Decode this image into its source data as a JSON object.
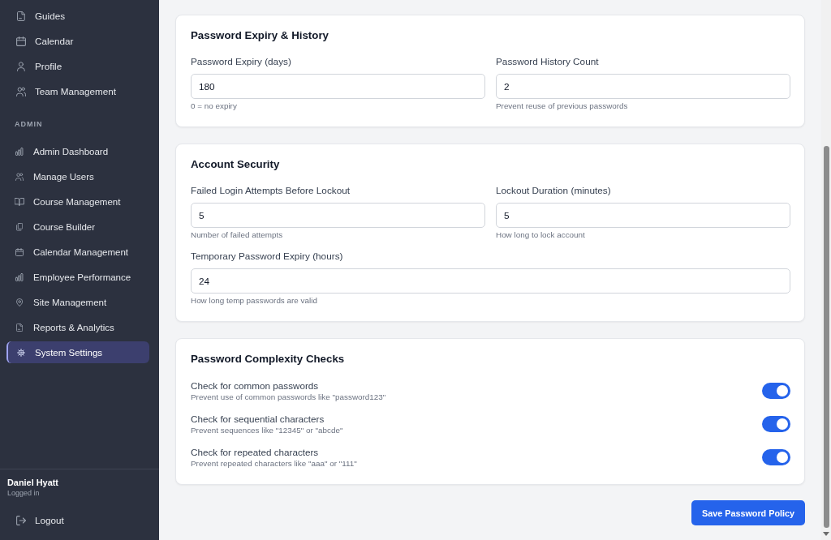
{
  "sidebar": {
    "items": [
      {
        "label": "Guides",
        "selected": false
      },
      {
        "label": "Calendar",
        "selected": false
      },
      {
        "label": "Profile",
        "selected": false
      },
      {
        "label": "Team Management",
        "selected": false
      }
    ],
    "admin_section": {
      "heading": "ADMIN",
      "items": [
        {
          "label": "Admin Dashboard",
          "selected": false
        },
        {
          "label": "Manage Users",
          "selected": false
        },
        {
          "label": "Course Management",
          "selected": false
        },
        {
          "label": "Course Builder",
          "selected": false
        },
        {
          "label": "Calendar Management",
          "selected": false
        },
        {
          "label": "Employee Performance",
          "selected": false
        },
        {
          "label": "Site Management",
          "selected": false
        },
        {
          "label": "Reports & Analytics",
          "selected": false
        },
        {
          "label": "System Settings",
          "selected": true
        }
      ]
    },
    "user": {
      "name": "Daniel Hyatt",
      "status": "Logged in"
    },
    "logout": {
      "label": "Logout"
    }
  },
  "cards": [
    {
      "kind": "fields",
      "title": "Password Expiry & History",
      "rows": [
        [
          {
            "label": "Password Expiry (days)",
            "value": "180",
            "hint": "0 = no expiry"
          },
          {
            "label": "Password History Count",
            "value": "2",
            "hint": "Prevent reuse of previous passwords"
          }
        ]
      ]
    },
    {
      "kind": "fields",
      "title": "Account Security",
      "rows": [
        [
          {
            "label": "Failed Login Attempts Before Lockout",
            "value": "5",
            "hint": "Number of failed attempts"
          },
          {
            "label": "Lockout Duration (minutes)",
            "value": "5",
            "hint": "How long to lock account"
          }
        ],
        [
          {
            "label": "Temporary Password Expiry (hours)",
            "value": "24",
            "hint": "How long temp passwords are valid"
          }
        ]
      ]
    },
    {
      "kind": "toggles",
      "title": "Password Complexity Checks",
      "toggles": [
        {
          "label": "Check for common passwords",
          "description": "Prevent use of common passwords like \"password123\"",
          "on": true
        },
        {
          "label": "Check for sequential characters",
          "description": "Prevent sequences like \"12345\" or \"abcde\"",
          "on": true
        },
        {
          "label": "Check for repeated characters",
          "description": "Prevent repeated characters like \"aaa\" or \"111\"",
          "on": true
        }
      ]
    }
  ],
  "save_button": {
    "label": "Save Password Policy"
  }
}
